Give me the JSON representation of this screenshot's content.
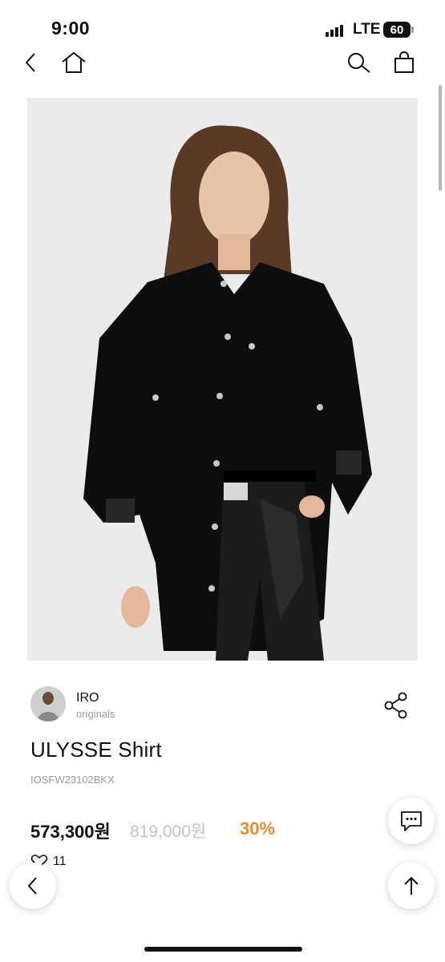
{
  "status_bar": {
    "time": "9:00",
    "network": "LTE",
    "battery": "60"
  },
  "brand": {
    "name": "IRO",
    "subtitle": "originals"
  },
  "product": {
    "title": "ULYSSE Shirt",
    "code": "IOSFW23102BKX",
    "price": "573,300원",
    "original_price": "819,000원",
    "discount": "30%",
    "likes": "11"
  },
  "colors": {
    "discount": "#e98b2e",
    "image_bg": "#ebebeb"
  },
  "icons": [
    "back-icon",
    "home-icon",
    "search-icon",
    "bag-icon",
    "share-icon",
    "chat-icon",
    "heart-icon",
    "arrow-up-icon"
  ]
}
